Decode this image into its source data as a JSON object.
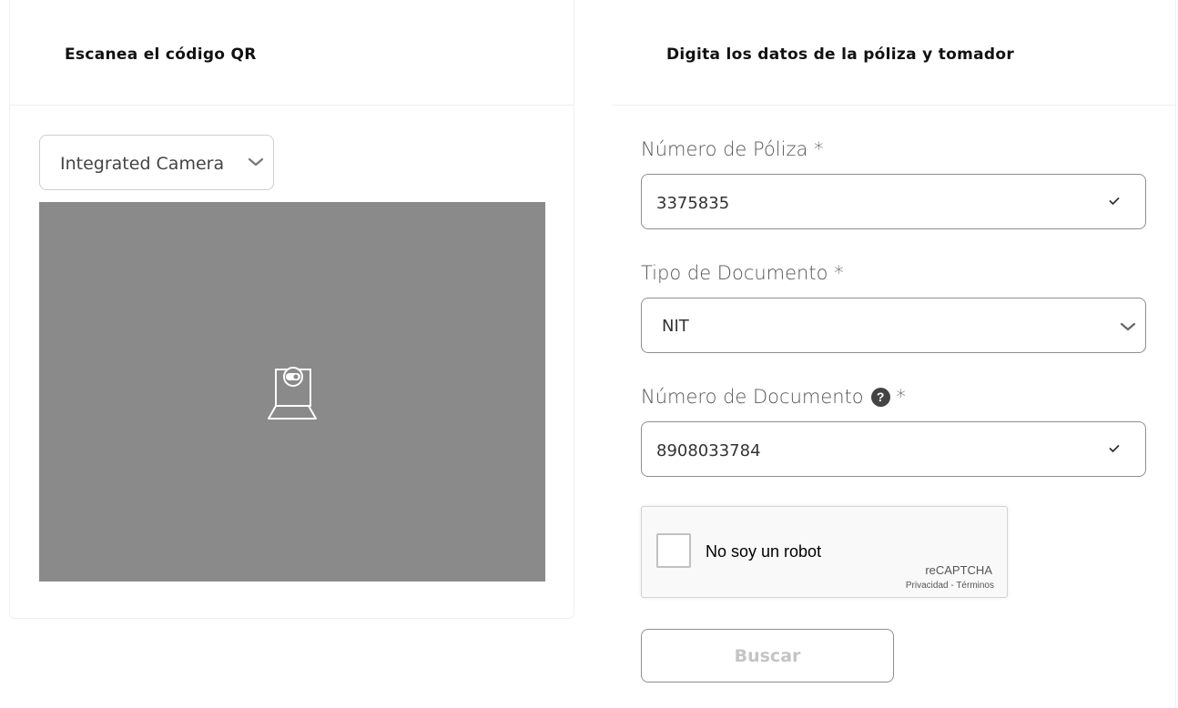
{
  "qr_card": {
    "title": "Escanea el código QR",
    "camera_select": {
      "value": "Integrated Camera",
      "icon": "chevron-down-icon"
    },
    "camera_view": {
      "icon": "webcam-icon",
      "background": "#8a8a8a"
    }
  },
  "form_card": {
    "title": "Digita los datos de la póliza y tomador",
    "policy_number": {
      "label": "Número de Póliza *",
      "value": "3375835",
      "valid_icon": "check-icon"
    },
    "document_type": {
      "label": "Tipo de Documento *",
      "value": "NIT",
      "icon": "chevron-down-icon"
    },
    "document_number": {
      "label": "Número de Documento",
      "required_mark": "*",
      "help_icon": "?",
      "value": "8908033784",
      "valid_icon": "check-icon"
    },
    "recaptcha": {
      "label": "No soy un robot",
      "brand": "reCAPTCHA",
      "privacy": "Privacidad",
      "separator": "-",
      "terms": "Términos"
    },
    "search_button": {
      "label": "Buscar",
      "state": "disabled"
    }
  }
}
